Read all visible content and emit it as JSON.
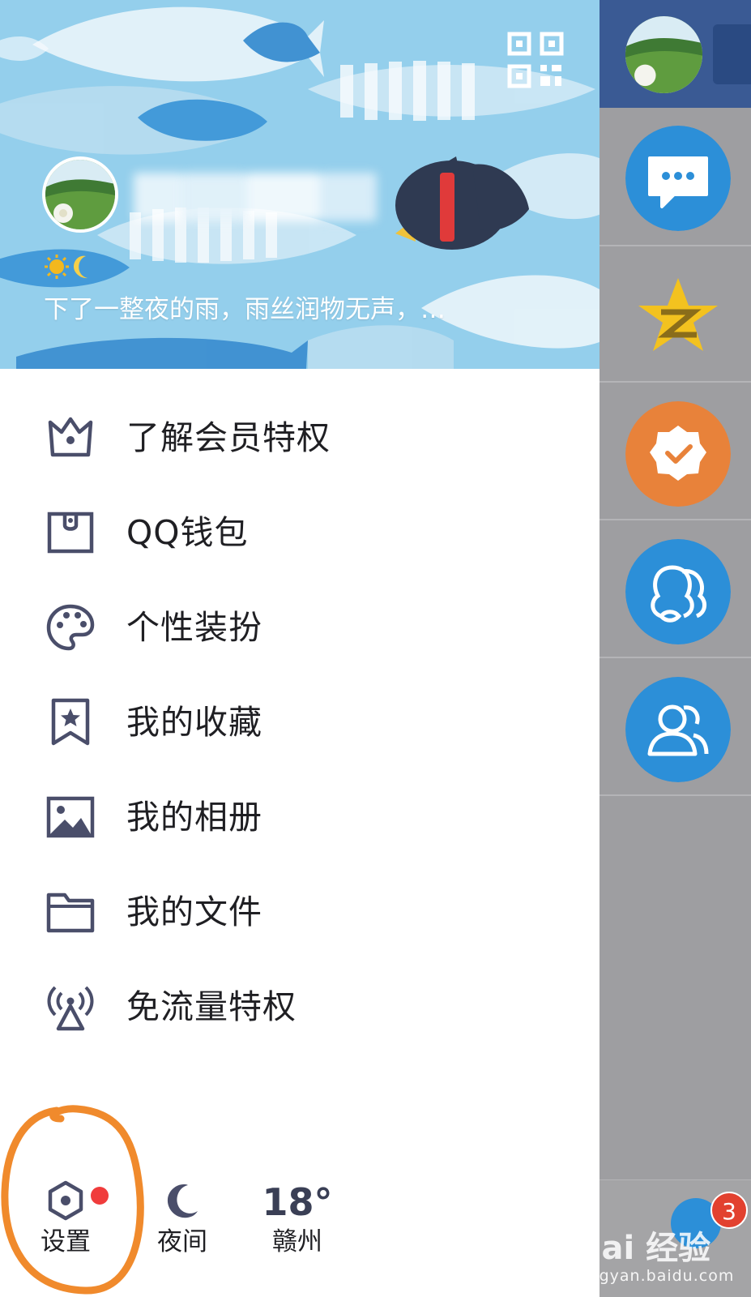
{
  "profile": {
    "signature": "下了一整夜的雨，雨丝润物无声，…",
    "status_icons": [
      "sun-icon",
      "moon-icon"
    ]
  },
  "menu": {
    "items": [
      {
        "label": "了解会员特权",
        "icon": "crown-icon"
      },
      {
        "label": "QQ钱包",
        "icon": "wallet-icon"
      },
      {
        "label": "个性装扮",
        "icon": "palette-icon"
      },
      {
        "label": "我的收藏",
        "icon": "bookmark-star-icon"
      },
      {
        "label": "我的相册",
        "icon": "photo-album-icon"
      },
      {
        "label": "我的文件",
        "icon": "folder-icon"
      },
      {
        "label": "免流量特权",
        "icon": "signal-tower-icon"
      }
    ]
  },
  "bottom_bar": {
    "settings_label": "设置",
    "night_label": "夜间",
    "weather_temp": "18°",
    "weather_city": "赣州"
  },
  "side_strip": {
    "icons": [
      "chat-bubble-icon",
      "qzone-star-icon",
      "verified-badge-icon",
      "friends-icon",
      "contacts-icon"
    ],
    "unread_badge": "3"
  },
  "watermark": {
    "main": "Bai 经验",
    "sub": "jingyan.baidu.com"
  },
  "colors": {
    "header_bg": "#94cfec",
    "icon_dark": "#4a4e6a",
    "strip_bg": "#9e9ea1",
    "strip_blue": "#2c8fd8",
    "orange": "#e8823a",
    "annotation": "#f08a2c",
    "red_dot": "#f03c3c"
  }
}
